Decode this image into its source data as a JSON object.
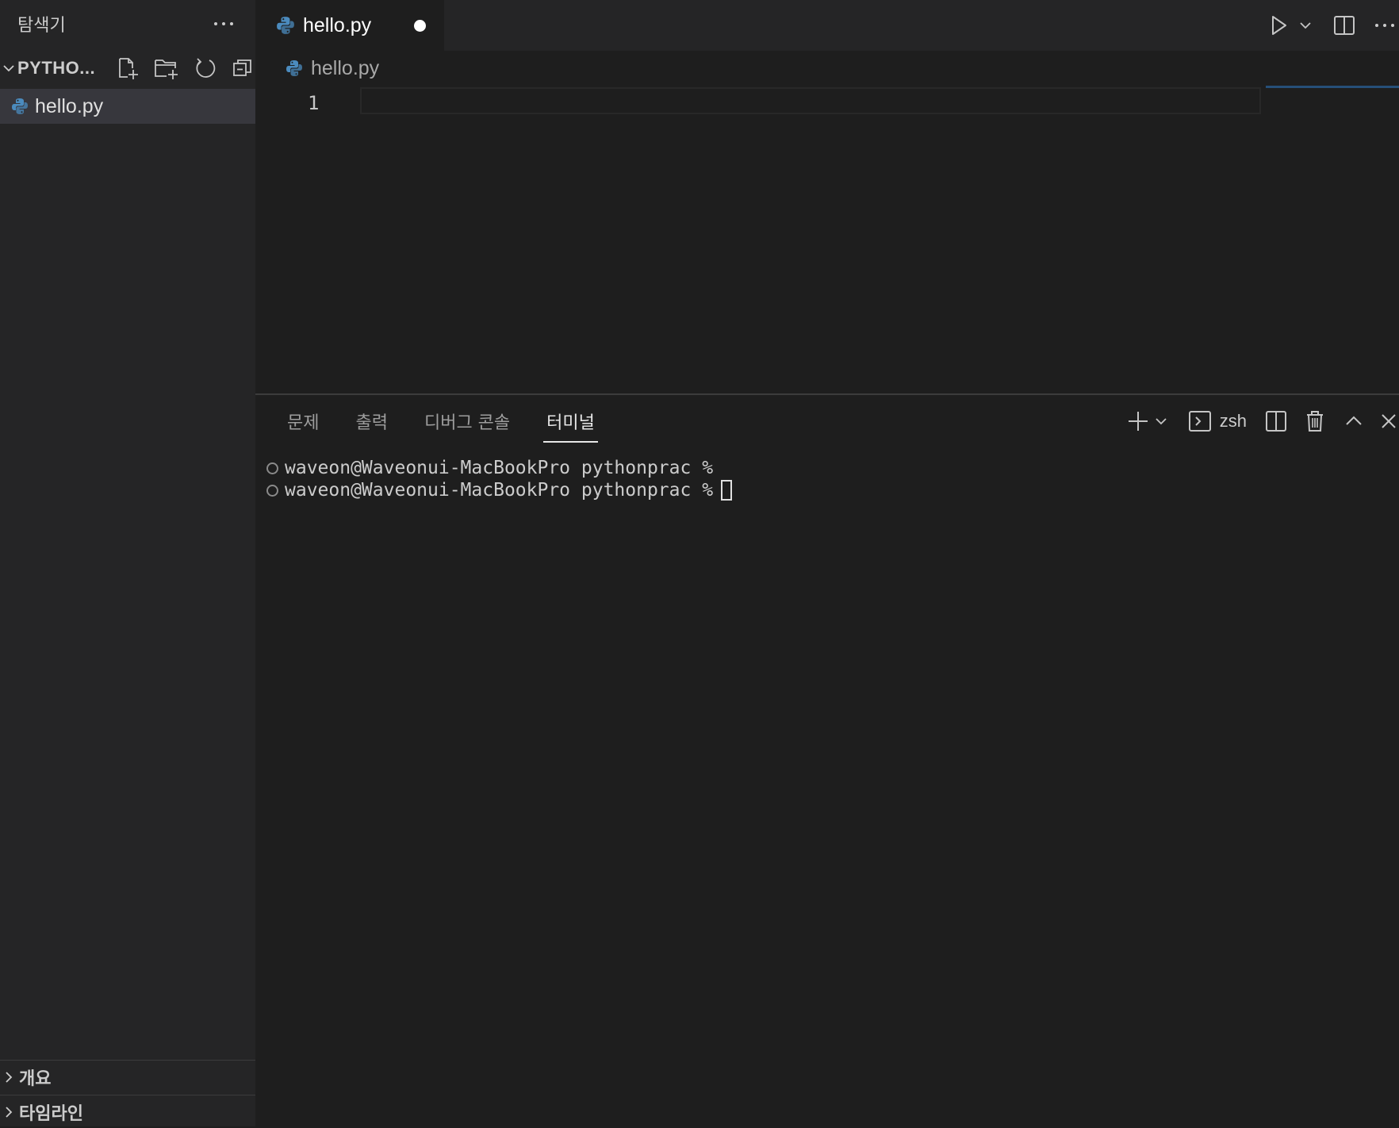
{
  "sidebar": {
    "title": "탐색기",
    "folder_name": "PYTHO...",
    "files": [
      {
        "label": "hello.py"
      }
    ],
    "sections": [
      {
        "label": "개요"
      },
      {
        "label": "타임라인"
      }
    ]
  },
  "editor": {
    "tab": {
      "label": "hello.py",
      "dirty": true
    },
    "breadcrumb": {
      "label": "hello.py"
    },
    "line_number": "1"
  },
  "panel": {
    "tabs": [
      {
        "label": "문제"
      },
      {
        "label": "출력"
      },
      {
        "label": "디버그 콘솔"
      },
      {
        "label": "터미널",
        "active": true
      }
    ],
    "shell_name": "zsh"
  },
  "terminal": {
    "lines": [
      "waveon@Waveonui-MacBookPro pythonprac %",
      "waveon@Waveonui-MacBookPro pythonprac %"
    ]
  },
  "colors": {
    "background": "#1e1e1e",
    "sidebar": "#252526",
    "python_icon": "#4b8bbe",
    "selected_row": "#37373d"
  }
}
